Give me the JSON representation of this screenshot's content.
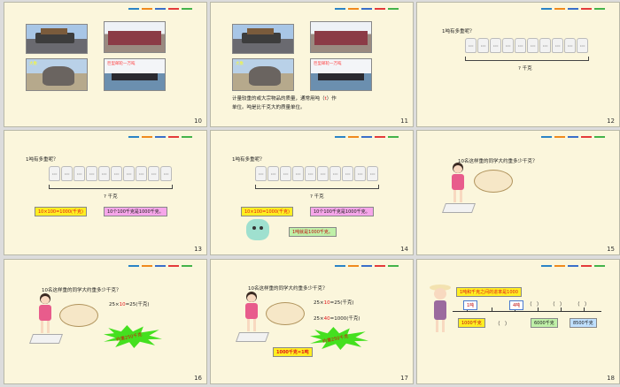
{
  "colors": {
    "stripe": [
      "#2b84c6",
      "#f08a1d",
      "#3a6fc9",
      "#e43b3b",
      "#44b34a"
    ],
    "yellow": "#ffee22",
    "pink": "#f6a6ea",
    "green": "#bff0a8",
    "slide_bg": "#fbf6dc"
  },
  "slides": [
    {
      "number": "10",
      "photos": [
        {
          "icon": "truck-photo",
          "label": ""
        },
        {
          "icon": "train-car-photo",
          "label": ""
        },
        {
          "icon": "elephant-photo",
          "label": "大象"
        },
        {
          "icon": "ship-photo",
          "label": "巨型邮轮一万吨"
        }
      ]
    },
    {
      "number": "11",
      "photos": [
        {
          "icon": "truck-photo",
          "label": ""
        },
        {
          "icon": "train-car-photo",
          "label": ""
        },
        {
          "icon": "elephant-photo",
          "label": "大象"
        },
        {
          "icon": "ship-photo",
          "label": "巨型邮轮一万吨"
        }
      ],
      "text1": "计量较重的或大宗物品的质量，通常用吨（",
      "text1_red": "t",
      "text1_end": "）作",
      "text2": "单位。吨是比千克大的质量单位。"
    },
    {
      "number": "12",
      "question": "1吨有多重呢？",
      "brace_label": "? 千克"
    },
    {
      "number": "13",
      "question": "1吨有多重呢？",
      "brace_label": "? 千克",
      "eq_yellow": "10×100=1000(千克)",
      "eq_pink": "10个100千克是1000千克。"
    },
    {
      "number": "14",
      "question": "1吨有多重呢？",
      "brace_label": "? 千克",
      "eq_yellow": "10×100=1000(千克)",
      "eq_pink": "10个100千克是1000千克。",
      "eq_green": "1吨就是1000千克。"
    },
    {
      "number": "15",
      "question": "10名这样重的同学大约重多少千克？"
    },
    {
      "number": "16",
      "question": "10名这样重的同学大约重多少千克？",
      "eq1_a": "25×",
      "eq1_b": "10",
      "eq1_c": "=25(千克)",
      "star_text": "约重250千克"
    },
    {
      "number": "17",
      "question": "10名这样重的同学大约重多少千克？",
      "eq1_a": "25×",
      "eq1_b": "10",
      "eq1_c": "=25(千克)",
      "eq2_a": "25×",
      "eq2_b": "40",
      "eq2_c": "=1000(千克)",
      "star_text": "约重250千克",
      "yellow_label": "1000千克=1吨"
    },
    {
      "number": "18",
      "banner": "1吨和千克之间的进率是1000",
      "ticks_top": [
        "1吨",
        "",
        "4吨",
        "（　）",
        "（　）",
        "（　）"
      ],
      "ticks_bottom": [
        "1000千克",
        "（　）",
        "6000千克",
        "8500千克"
      ]
    }
  ]
}
